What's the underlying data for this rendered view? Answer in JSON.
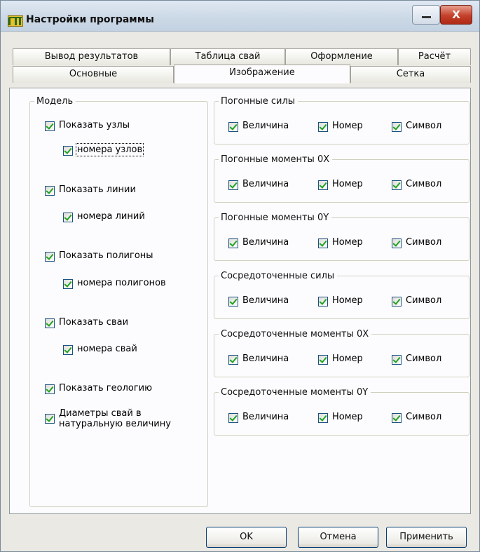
{
  "window": {
    "title": "Настройки программы",
    "close_symbol": "X"
  },
  "tabs": {
    "row1": [
      "Вывод результатов",
      "Таблица свай",
      "Оформление",
      "Расчёт"
    ],
    "row2": [
      "Основные",
      "Изображение",
      "Сетка"
    ],
    "active": "Изображение"
  },
  "model": {
    "legend": "Модель",
    "items": [
      {
        "label": "Показать узлы",
        "checked": true
      },
      {
        "label": "номера узлов",
        "checked": true,
        "focused": true
      },
      {
        "label": "Показать линии",
        "checked": true
      },
      {
        "label": "номера линий",
        "checked": true
      },
      {
        "label": "Показать полигоны",
        "checked": true
      },
      {
        "label": "номера полигонов",
        "checked": true
      },
      {
        "label": "Показать сваи",
        "checked": true
      },
      {
        "label": "номера свай",
        "checked": true
      },
      {
        "label": "Показать геологию",
        "checked": true
      },
      {
        "label": "Диаметры свай в натуральную величину",
        "checked": true
      }
    ]
  },
  "force_groups": [
    {
      "legend": "Погонные силы",
      "options": [
        "Величина",
        "Номер",
        "Символ"
      ]
    },
    {
      "legend": "Погонные моменты 0X",
      "options": [
        "Величина",
        "Номер",
        "Символ"
      ]
    },
    {
      "legend": "Погонные моменты 0Y",
      "options": [
        "Величина",
        "Номер",
        "Символ"
      ]
    },
    {
      "legend": "Сосредоточенные силы",
      "options": [
        "Величина",
        "Номер",
        "Символ"
      ]
    },
    {
      "legend": "Сосредоточенные моменты 0X",
      "options": [
        "Величина",
        "Номер",
        "Символ"
      ]
    },
    {
      "legend": "Сосредоточенные моменты 0Y",
      "options": [
        "Величина",
        "Номер",
        "Символ"
      ]
    }
  ],
  "buttons": {
    "ok": "OK",
    "cancel": "Отмена",
    "apply": "Применить"
  },
  "colors": {
    "check_mark": "#21a121",
    "title_bar": "#cbd8e6",
    "close_button": "#c4402a"
  }
}
